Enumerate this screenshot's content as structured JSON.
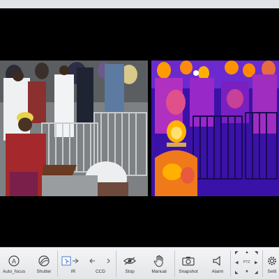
{
  "toolbar": {
    "items": [
      {
        "label": "Auto_focus",
        "icon": "auto-focus-icon"
      },
      {
        "label": "Shutter",
        "icon": "shutter-icon"
      },
      {
        "label": "IR",
        "icon": "ir-icon"
      },
      {
        "label": "CCD",
        "icon": "ccd-icon"
      },
      {
        "label": "Stop",
        "icon": "stop-icon"
      },
      {
        "label": "Manual",
        "icon": "manual-hand-icon"
      },
      {
        "label": "Snapshot",
        "icon": "camera-icon"
      },
      {
        "label": "Alarm",
        "icon": "speaker-icon"
      },
      {
        "label": "Setti",
        "icon": "gear-icon"
      }
    ],
    "ptz_label": "PTZ"
  },
  "colors": {
    "toolbar_bg": "#e9ebee",
    "thermal_dark": "#2a0a8a",
    "thermal_hot": "#ffb000"
  }
}
